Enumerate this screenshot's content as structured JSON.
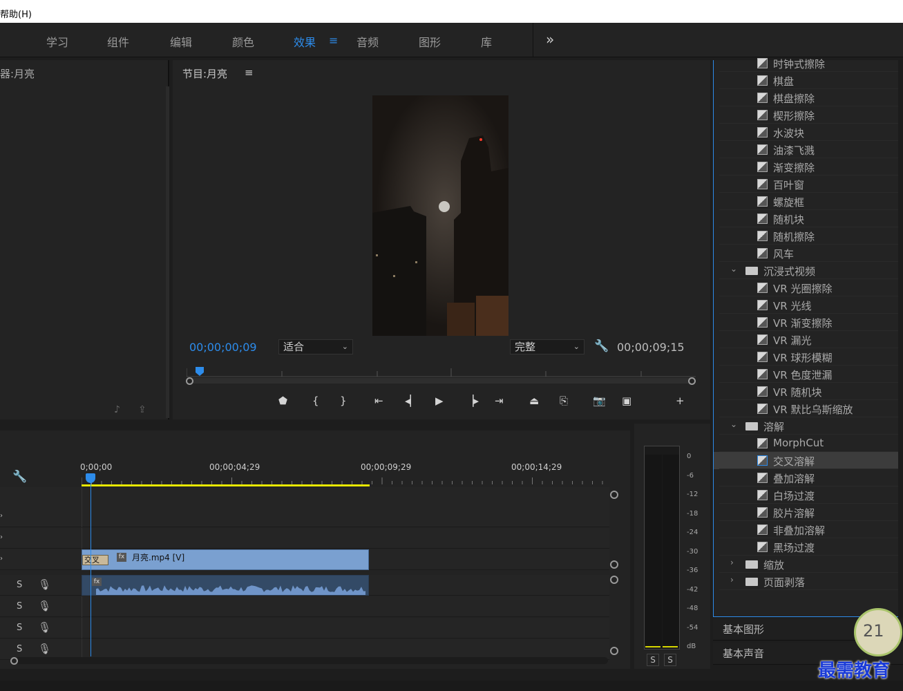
{
  "menubar": {
    "help": "帮助(H)"
  },
  "workspaces": {
    "tabs": [
      "学习",
      "组件",
      "编辑",
      "颜色",
      "效果",
      "音频",
      "图形",
      "库"
    ],
    "active_index": 4,
    "menu_glyph": "≡",
    "more_glyph": "»"
  },
  "source": {
    "title": "器:月亮"
  },
  "program": {
    "title": "节目:月亮",
    "menu_glyph": "≡",
    "timecode_current": "00;00;00;09",
    "zoom": "适合",
    "quality": "完整",
    "timecode_total": "00;00;09;15"
  },
  "effects": {
    "items": [
      {
        "type": "effect",
        "label": "时钟式擦除"
      },
      {
        "type": "effect",
        "label": "棋盘"
      },
      {
        "type": "effect",
        "label": "棋盘擦除"
      },
      {
        "type": "effect",
        "label": "楔形擦除"
      },
      {
        "type": "effect",
        "label": "水波块"
      },
      {
        "type": "effect",
        "label": "油漆飞溅"
      },
      {
        "type": "effect",
        "label": "渐变擦除"
      },
      {
        "type": "effect",
        "label": "百叶窗"
      },
      {
        "type": "effect",
        "label": "螺旋框"
      },
      {
        "type": "effect",
        "label": "随机块"
      },
      {
        "type": "effect",
        "label": "随机擦除"
      },
      {
        "type": "effect",
        "label": "风车"
      },
      {
        "type": "folder",
        "label": "沉浸式视频",
        "expanded": true
      },
      {
        "type": "effect",
        "label": "VR 光圈擦除"
      },
      {
        "type": "effect",
        "label": "VR 光线"
      },
      {
        "type": "effect",
        "label": "VR 渐变擦除"
      },
      {
        "type": "effect",
        "label": "VR 漏光"
      },
      {
        "type": "effect",
        "label": "VR 球形模糊"
      },
      {
        "type": "effect",
        "label": "VR 色度泄漏"
      },
      {
        "type": "effect",
        "label": "VR 随机块"
      },
      {
        "type": "effect",
        "label": "VR 默比乌斯缩放"
      },
      {
        "type": "folder",
        "label": "溶解",
        "expanded": true
      },
      {
        "type": "effect",
        "label": "MorphCut"
      },
      {
        "type": "effect",
        "label": "交叉溶解",
        "selected": true
      },
      {
        "type": "effect",
        "label": "叠加溶解"
      },
      {
        "type": "effect",
        "label": "白场过渡"
      },
      {
        "type": "effect",
        "label": "胶片溶解"
      },
      {
        "type": "effect",
        "label": "非叠加溶解"
      },
      {
        "type": "effect",
        "label": "黑场过渡"
      },
      {
        "type": "folder",
        "label": "缩放",
        "expanded": false
      },
      {
        "type": "folder",
        "label": "页面剥落",
        "expanded": false
      }
    ]
  },
  "panels": {
    "basic_graphics": "基本图形",
    "basic_audio": "基本声音"
  },
  "timeline": {
    "ruler": [
      "0;00;00",
      "00;00;04;29",
      "00;00;09;29",
      "00;00;14;29"
    ],
    "video_clip": "月亮.mp4 [V]",
    "transition": "交叉",
    "fx_badge": "fx",
    "solo_label": "S",
    "mic_glyph": "🎙"
  },
  "meter": {
    "db_labels": [
      "0",
      "-6",
      "-12",
      "-18",
      "-24",
      "-30",
      "-36",
      "-42",
      "-48",
      "-54",
      "dB"
    ],
    "solo": [
      "S",
      "S"
    ]
  },
  "watermark": {
    "text": "最需教育",
    "badge_number": "21"
  },
  "colors": {
    "accent": "#2d8ceb",
    "clip_video": "#7aa0d0",
    "clip_audio": "#334a66",
    "work_area": "#e8e800"
  }
}
